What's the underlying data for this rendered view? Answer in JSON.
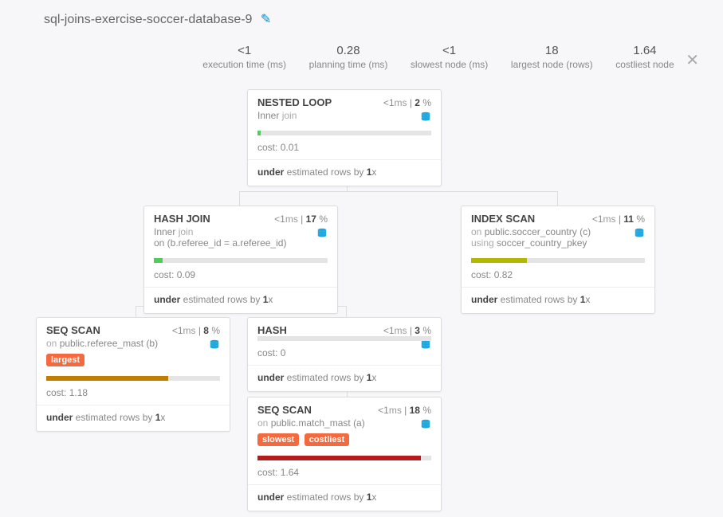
{
  "title": "sql-joins-exercise-soccer-database-9",
  "stats": {
    "exec_value": "<1",
    "exec_label": "execution time (ms)",
    "plan_value": "0.28",
    "plan_label": "planning time (ms)",
    "slow_value": "<1",
    "slow_label": "slowest node (ms)",
    "large_value": "18",
    "large_label": "largest node (rows)",
    "cost_value": "1.64",
    "cost_label": "costliest node"
  },
  "nodes": {
    "nested_loop": {
      "op": "NESTED LOOP",
      "time_html": "<1ms | 2 %",
      "time": "<1",
      "time_unit": "ms",
      "pct": "2",
      "pctu": "%",
      "join_type": "Inner",
      "join_word": "join",
      "cost_label": "cost:",
      "cost": "0.01",
      "est_pre": "under",
      "est_mid": " estimated rows by ",
      "est_x": "1",
      "est_suf": "x",
      "bar_color": "#4fcd5a",
      "bar_pct": 2
    },
    "hash_join": {
      "op": "HASH JOIN",
      "time": "<1",
      "time_unit": "ms",
      "pct": "17",
      "pctu": "%",
      "join_type": "Inner",
      "join_word": "join",
      "on": "on (b.referee_id = a.referee_id)",
      "cost_label": "cost:",
      "cost": "0.09",
      "est_pre": "under",
      "est_mid": " estimated rows by ",
      "est_x": "1",
      "est_suf": "x",
      "bar_color": "#4fcd5a",
      "bar_pct": 5
    },
    "index_scan": {
      "op": "INDEX SCAN",
      "time": "<1",
      "time_unit": "ms",
      "pct": "11",
      "pctu": "%",
      "detail_pre": "on ",
      "detail_rel": "public.soccer_country (c)",
      "detail_using_pre": "using ",
      "detail_using": "soccer_country_pkey",
      "cost_label": "cost:",
      "cost": "0.82",
      "est_pre": "under",
      "est_mid": " estimated rows by ",
      "est_x": "1",
      "est_suf": "x",
      "bar_color": "#b3b700",
      "bar_pct": 32
    },
    "seq_scan_b": {
      "op": "SEQ SCAN",
      "time": "<1",
      "time_unit": "ms",
      "pct": "8",
      "pctu": "%",
      "detail_pre": "on ",
      "detail_rel": "public.referee_mast (b)",
      "tag1": "largest",
      "cost_label": "cost:",
      "cost": "1.18",
      "est_pre": "under",
      "est_mid": " estimated rows by ",
      "est_x": "1",
      "est_suf": "x",
      "bar_color": "#c07d00",
      "bar_pct": 70
    },
    "hash": {
      "op": "HASH",
      "time": "<1",
      "time_unit": "ms",
      "pct": "3",
      "pctu": "%",
      "cost_label": "cost:",
      "cost": "0",
      "est_pre": "under",
      "est_mid": " estimated rows by ",
      "est_x": "1",
      "est_suf": "x",
      "bar_color": "#4fcd5a",
      "bar_pct": 0
    },
    "seq_scan_a": {
      "op": "SEQ SCAN",
      "time": "<1",
      "time_unit": "ms",
      "pct": "18",
      "pctu": "%",
      "detail_pre": "on ",
      "detail_rel": "public.match_mast (a)",
      "tag1": "slowest",
      "tag2": "costliest",
      "cost_label": "cost:",
      "cost": "1.64",
      "est_pre": "under",
      "est_mid": " estimated rows by ",
      "est_x": "1",
      "est_suf": "x",
      "bar_color": "#b71c1c",
      "bar_pct": 94
    }
  }
}
